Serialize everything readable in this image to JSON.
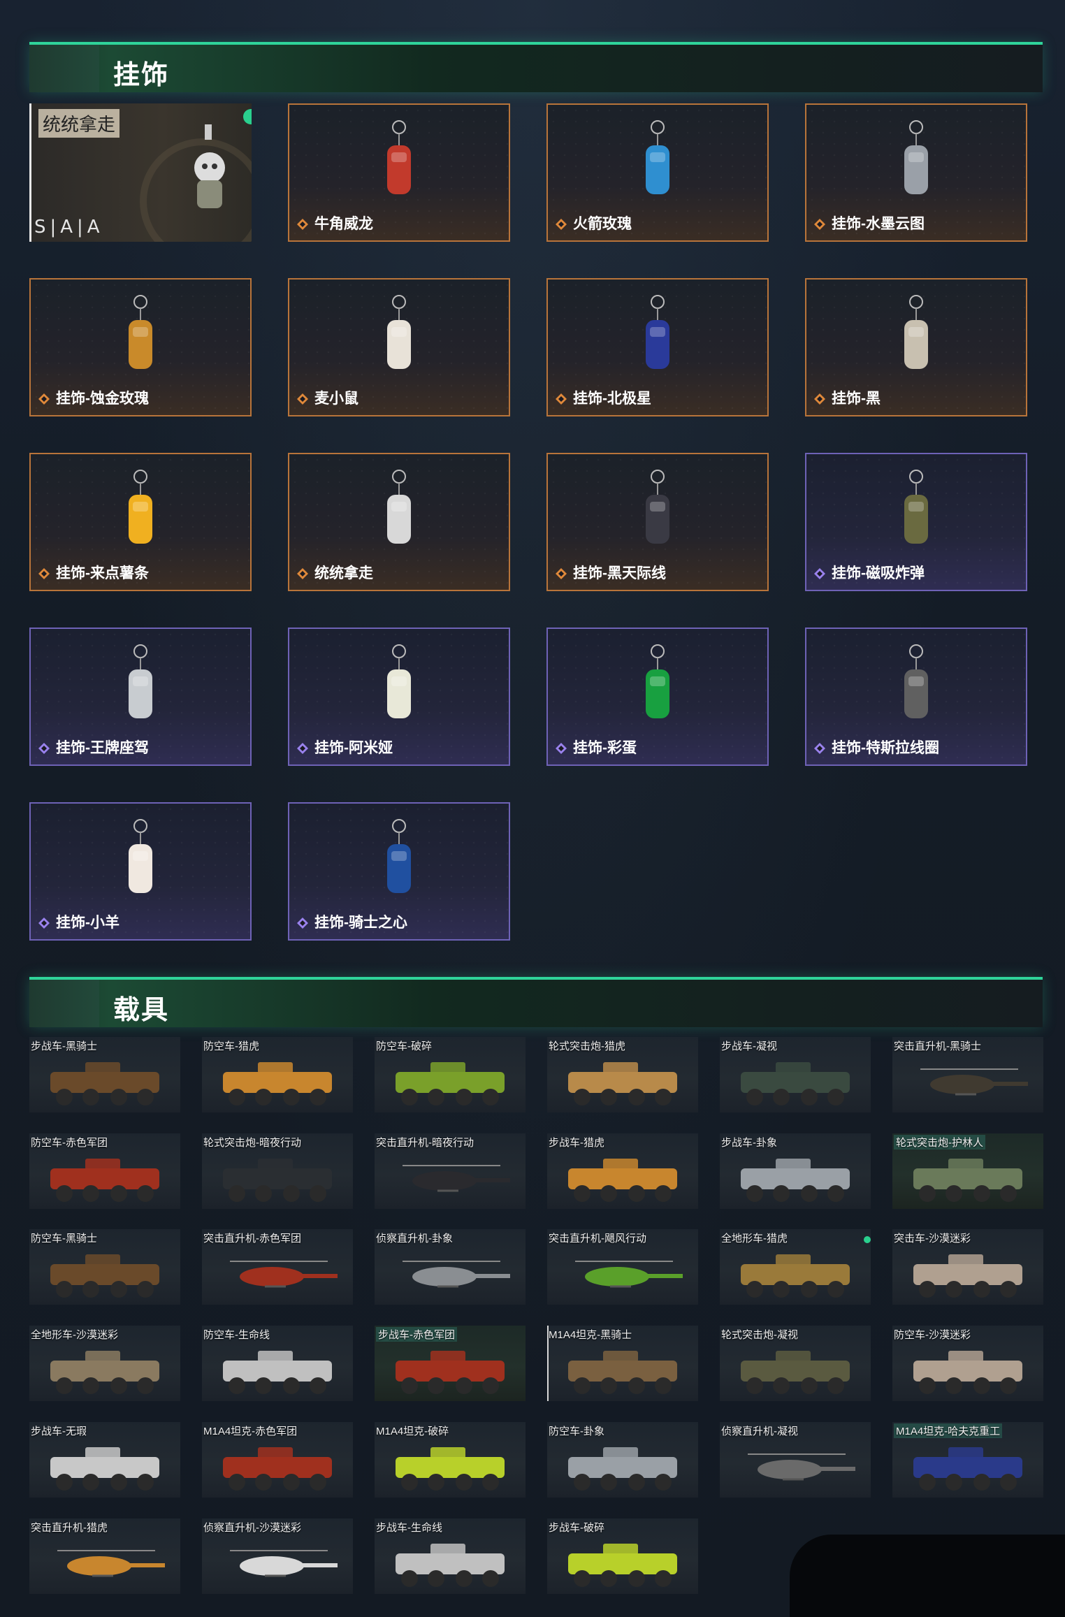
{
  "sections": {
    "charms_title": "挂饰",
    "vehicles_title": "载具"
  },
  "selected_charm": {
    "overlay_label": "统统拿走",
    "brand": "S|A|A"
  },
  "charms": [
    {
      "label": "牛角威龙",
      "rarity": "orange"
    },
    {
      "label": "火箭玫瑰",
      "rarity": "orange"
    },
    {
      "label": "挂饰-水墨云图",
      "rarity": "orange"
    },
    {
      "label": "挂饰-蚀金玫瑰",
      "rarity": "orange"
    },
    {
      "label": "麦小鼠",
      "rarity": "orange"
    },
    {
      "label": "挂饰-北极星",
      "rarity": "orange"
    },
    {
      "label": "挂饰-黑",
      "rarity": "orange"
    },
    {
      "label": "挂饰-来点薯条",
      "rarity": "orange"
    },
    {
      "label": "统统拿走",
      "rarity": "orange"
    },
    {
      "label": "挂饰-黑天际线",
      "rarity": "orange"
    },
    {
      "label": "挂饰-磁吸炸弹",
      "rarity": "purple"
    },
    {
      "label": "挂饰-王牌座驾",
      "rarity": "purple"
    },
    {
      "label": "挂饰-阿米娅",
      "rarity": "purple"
    },
    {
      "label": "挂饰-彩蛋",
      "rarity": "purple"
    },
    {
      "label": "挂饰-特斯拉线圈",
      "rarity": "purple"
    },
    {
      "label": "挂饰-小羊",
      "rarity": "purple"
    },
    {
      "label": "挂饰-骑士之心",
      "rarity": "purple"
    }
  ],
  "vehicles": [
    "步战车-黑骑士",
    "防空车-猎虎",
    "防空车-破碎",
    "轮式突击炮-猎虎",
    "步战车-凝视",
    "突击直升机-黑骑士",
    "防空车-赤色军团",
    "轮式突击炮-暗夜行动",
    "突击直升机-暗夜行动",
    "步战车-猎虎",
    "步战车-卦象",
    "轮式突击炮-护林人",
    "防空车-黑骑士",
    "突击直升机-赤色军团",
    "侦察直升机-卦象",
    "突击直升机-飓风行动",
    "全地形车-猎虎",
    "突击车-沙漠迷彩",
    "全地形车-沙漠迷彩",
    "防空车-生命线",
    "步战车-赤色军团",
    "M1A4坦克-黑骑士",
    "轮式突击炮-凝视",
    "防空车-沙漠迷彩",
    "步战车-无瑕",
    "M1A4坦克-赤色军团",
    "M1A4坦克-破碎",
    "防空车-卦象",
    "侦察直升机-凝视",
    "M1A4坦克-哈夫克重工",
    "突击直升机-猎虎",
    "侦察直升机-沙漠迷彩",
    "步战车-生命线",
    "步战车-破碎"
  ],
  "colors": {
    "accent": "#2fd49a",
    "rarity_orange": "#e0893a",
    "rarity_purple": "#9a82ee"
  }
}
